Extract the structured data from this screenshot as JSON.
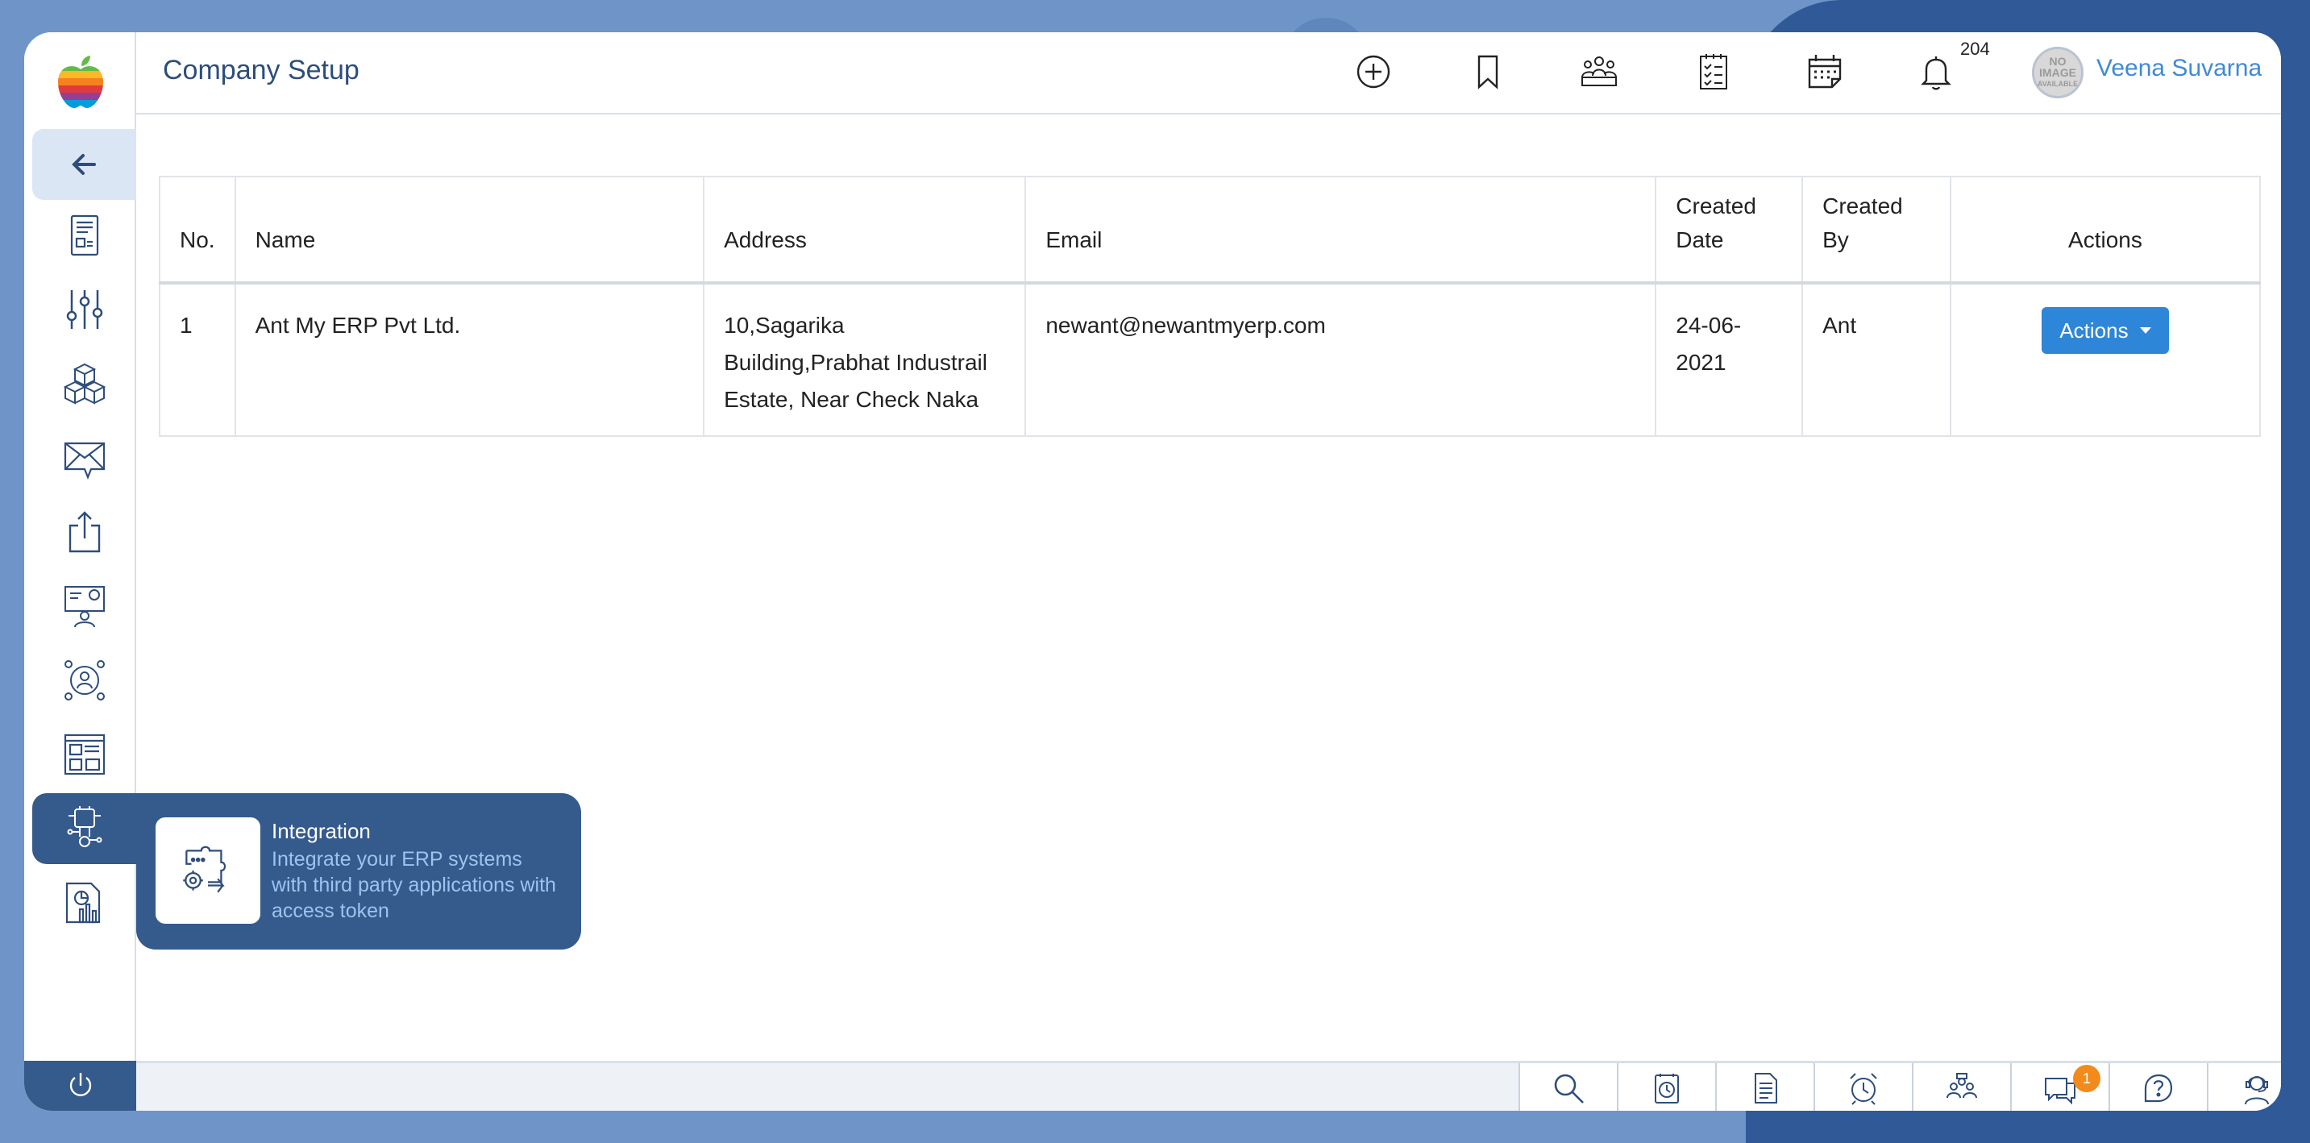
{
  "header": {
    "title": "Company Setup",
    "notification_count": "204",
    "avatar_text": [
      "NO",
      "IMAGE",
      "AVAILABLE"
    ],
    "user_name": "Veena Suvarna"
  },
  "table": {
    "columns": [
      "No.",
      "Name",
      "Address",
      "Email",
      "Created Date",
      "Created By",
      "Actions"
    ],
    "rows": [
      {
        "no": "1",
        "name": "Ant My ERP Pvt Ltd.",
        "address": "10,Sagarika Building,Prabhat Industrail Estate, Near Check Naka",
        "email": "newant@newantmyerp.com",
        "created_date": "24-06-2021",
        "created_by": "Ant",
        "action_label": "Actions"
      }
    ]
  },
  "tooltip": {
    "title": "Integration",
    "description": "Integrate your ERP systems with third party applications with access token"
  },
  "footer": {
    "chat_badge": "1"
  },
  "colors": {
    "primary": "#355a8c",
    "accent": "#2e86d8",
    "badge": "#f28a1c",
    "title": "#2d4d7c"
  },
  "icons": {
    "sidebar": [
      "back-arrow-icon",
      "document-icon",
      "sliders-icon",
      "cubes-icon",
      "mail-icon",
      "upload-icon",
      "presentation-icon",
      "user-network-icon",
      "profile-card-icon",
      "integration-icon",
      "report-chart-icon"
    ],
    "header": [
      "add-circle-icon",
      "bookmark-icon",
      "team-icon",
      "checklist-icon",
      "calendar-icon",
      "bell-icon"
    ],
    "footer": [
      "search-icon",
      "timesheet-icon",
      "document-icon",
      "alarm-clock-icon",
      "meeting-icon",
      "chat-icon",
      "help-icon",
      "support-agent-icon"
    ]
  }
}
